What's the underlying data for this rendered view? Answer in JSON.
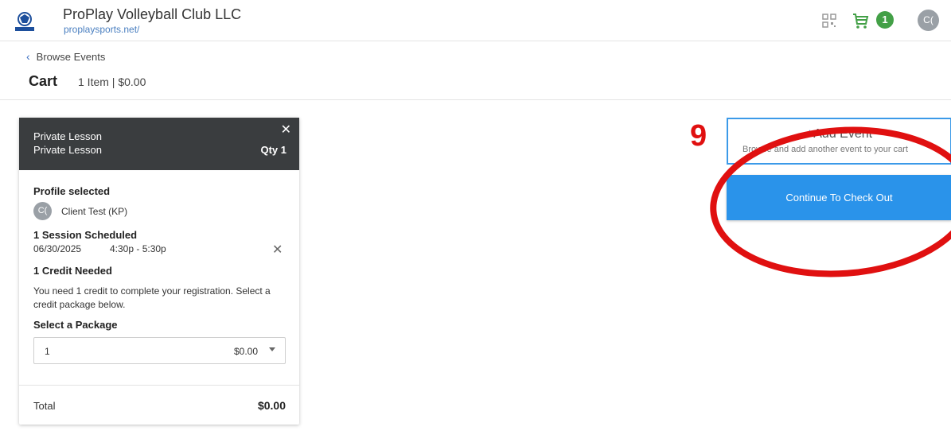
{
  "topbar": {
    "org_name": "ProPlay Volleyball Club LLC",
    "org_url": "proplaysports.net/",
    "cart_count": "1",
    "user_initials": "C(",
    "icons": {
      "logo": "proplay-logo",
      "qr": "qr-code-icon",
      "cart": "shopping-cart-icon"
    },
    "colors": {
      "cart_icon": "#43a047",
      "badge": "#43a047",
      "avatar": "#9aa0a6"
    }
  },
  "header": {
    "back_label": "Browse Events",
    "back_icon": "chevron-left-icon",
    "title": "Cart",
    "summary": "1 Item | $0.00"
  },
  "cart_item": {
    "line1": "Private Lesson",
    "line2": "Private Lesson",
    "qty": "Qty 1",
    "close_icon": "close-icon",
    "profile_title": "Profile selected",
    "profile_initials": "C(",
    "profile_name": "Client Test (KP)",
    "session_title": "1 Session Scheduled",
    "session_date": "06/30/2025",
    "session_time": "4:30p - 5:30p",
    "credit_title": "1 Credit Needed",
    "credit_text": "You need 1 credit to complete your registration. Select a credit package below.",
    "package_title": "Select a Package",
    "package_selected_qty": "1",
    "package_selected_price": "$0.00",
    "total_label": "Total",
    "total_value": "$0.00",
    "header_color": "#3a3d3f"
  },
  "actions": {
    "add_event_plus": "+",
    "add_event_label": "Add Event",
    "add_event_sub": "Browse and add another event to your cart",
    "checkout_label": "Continue To Check Out",
    "colors": {
      "primary": "#2a93ea",
      "outline": "#3c9ae8"
    }
  },
  "annotation": {
    "step_number": "9",
    "color": "#e01010"
  }
}
